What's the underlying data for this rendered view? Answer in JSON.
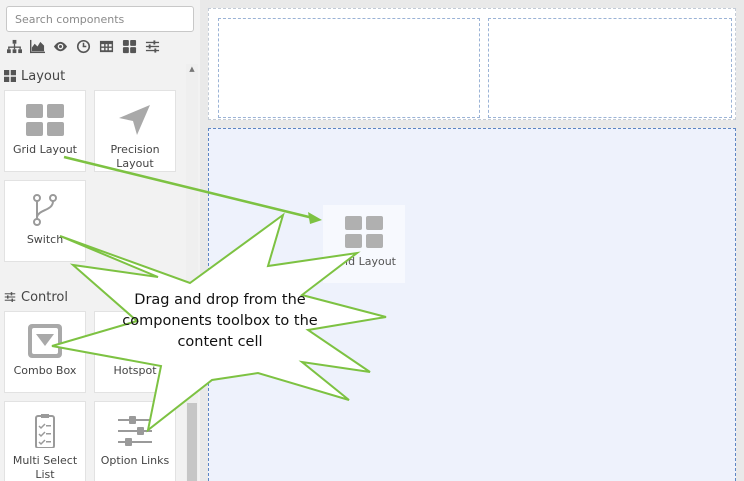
{
  "toolbox": {
    "search": {
      "placeholder": "Search components",
      "value": ""
    },
    "filters": [
      "hierarchy-icon",
      "area-chart-icon",
      "eye-icon",
      "clock-icon",
      "table-icon",
      "grid-icon",
      "sliders-icon"
    ],
    "sections": [
      {
        "title": "Layout",
        "icon": "grid-icon",
        "tiles": [
          {
            "label": "Grid Layout",
            "icon": "grid-layout-icon"
          },
          {
            "label": "Precision Layout",
            "icon": "cursor-arrow-icon"
          },
          {
            "label": "Switch",
            "icon": "branch-icon"
          }
        ]
      },
      {
        "title": "Control",
        "icon": "sliders-icon",
        "tiles": [
          {
            "label": "Combo Box",
            "icon": "combo-box-icon"
          },
          {
            "label": "Hotspot",
            "icon": "hotspot-icon"
          },
          {
            "label": "Multi Select List",
            "icon": "checklist-icon"
          },
          {
            "label": "Option Links",
            "icon": "option-links-icon"
          }
        ]
      }
    ]
  },
  "canvas": {
    "drag_ghost_label": "Grid Layout"
  },
  "callout": {
    "text": "Drag and drop from the components toolbox to the content cell"
  },
  "colors": {
    "accent": "#5e86c4",
    "callout_border": "#7dc242",
    "arrow": "#7dc242"
  }
}
